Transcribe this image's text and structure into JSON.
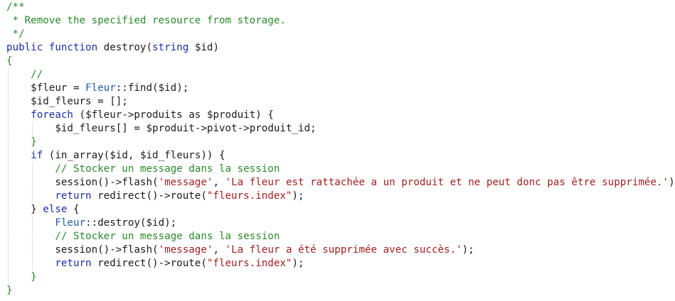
{
  "editor": {
    "language": "php",
    "lines": [
      {
        "indent": 0,
        "tokens": [
          {
            "t": "/**",
            "k": "comment"
          }
        ]
      },
      {
        "indent": 0,
        "tokens": [
          {
            "t": " * Remove the specified resource from storage.",
            "k": "comment"
          }
        ]
      },
      {
        "indent": 0,
        "tokens": [
          {
            "t": " */",
            "k": "comment"
          }
        ]
      },
      {
        "indent": 0,
        "tokens": [
          {
            "t": "public function ",
            "k": "keyword"
          },
          {
            "t": "destroy(",
            "k": "plain"
          },
          {
            "t": "string ",
            "k": "keyword"
          },
          {
            "t": "$id",
            "k": "variable"
          },
          {
            "t": ")",
            "k": "plain"
          }
        ]
      },
      {
        "indent": 0,
        "tokens": [
          {
            "t": "{",
            "k": "comment"
          }
        ]
      },
      {
        "indent": 1,
        "tokens": [
          {
            "t": "//",
            "k": "comment"
          }
        ]
      },
      {
        "indent": 1,
        "tokens": [
          {
            "t": "$fleur",
            "k": "variable"
          },
          {
            "t": " = ",
            "k": "plain"
          },
          {
            "t": "Fleur",
            "k": "class"
          },
          {
            "t": "::find(",
            "k": "plain"
          },
          {
            "t": "$id",
            "k": "variable"
          },
          {
            "t": ");",
            "k": "plain"
          }
        ]
      },
      {
        "indent": 1,
        "tokens": [
          {
            "t": "$id_fleurs",
            "k": "variable"
          },
          {
            "t": " = [];",
            "k": "plain"
          }
        ]
      },
      {
        "indent": 1,
        "tokens": [
          {
            "t": "foreach",
            "k": "keyword"
          },
          {
            "t": " (",
            "k": "plain"
          },
          {
            "t": "$fleur",
            "k": "variable"
          },
          {
            "t": "->produits as ",
            "k": "plain"
          },
          {
            "t": "$produit",
            "k": "variable"
          },
          {
            "t": ") {",
            "k": "plain"
          }
        ]
      },
      {
        "indent": 2,
        "tokens": [
          {
            "t": "$id_fleurs",
            "k": "variable"
          },
          {
            "t": "[] = ",
            "k": "plain"
          },
          {
            "t": "$produit",
            "k": "variable"
          },
          {
            "t": "->pivot->produit_id;",
            "k": "plain"
          }
        ]
      },
      {
        "indent": 1,
        "tokens": [
          {
            "t": "}",
            "k": "comment"
          }
        ]
      },
      {
        "indent": 1,
        "tokens": [
          {
            "t": "if",
            "k": "keyword"
          },
          {
            "t": " (in_array(",
            "k": "plain"
          },
          {
            "t": "$id",
            "k": "variable"
          },
          {
            "t": ", ",
            "k": "plain"
          },
          {
            "t": "$id_fleurs",
            "k": "variable"
          },
          {
            "t": ")) {",
            "k": "plain"
          }
        ]
      },
      {
        "indent": 2,
        "tokens": [
          {
            "t": "// Stocker un message dans la session",
            "k": "comment"
          }
        ]
      },
      {
        "indent": 2,
        "tokens": [
          {
            "t": "session()->flash(",
            "k": "plain"
          },
          {
            "t": "'message'",
            "k": "string"
          },
          {
            "t": ", ",
            "k": "plain"
          },
          {
            "t": "'La fleur est rattachée a un produit et ne peut donc pas être supprimée.'",
            "k": "string"
          },
          {
            "t": ");",
            "k": "plain"
          }
        ]
      },
      {
        "indent": 2,
        "tokens": [
          {
            "t": "return",
            "k": "keyword"
          },
          {
            "t": " redirect()->route(",
            "k": "plain"
          },
          {
            "t": "\"fleurs.index\"",
            "k": "string"
          },
          {
            "t": ");",
            "k": "plain"
          }
        ]
      },
      {
        "indent": 1,
        "tokens": [
          {
            "t": "} ",
            "k": "plain"
          },
          {
            "t": "else",
            "k": "keyword"
          },
          {
            "t": " {",
            "k": "plain"
          }
        ]
      },
      {
        "indent": 2,
        "tokens": [
          {
            "t": "Fleur",
            "k": "class"
          },
          {
            "t": "::destroy(",
            "k": "plain"
          },
          {
            "t": "$id",
            "k": "variable"
          },
          {
            "t": ");",
            "k": "plain"
          }
        ]
      },
      {
        "indent": 2,
        "tokens": [
          {
            "t": "// Stocker un message dans la session",
            "k": "comment"
          }
        ]
      },
      {
        "indent": 2,
        "tokens": [
          {
            "t": "session()->flash(",
            "k": "plain"
          },
          {
            "t": "'message'",
            "k": "string"
          },
          {
            "t": ", ",
            "k": "plain"
          },
          {
            "t": "'La fleur a été supprimée avec succès.'",
            "k": "string"
          },
          {
            "t": ");",
            "k": "plain"
          }
        ]
      },
      {
        "indent": 2,
        "tokens": [
          {
            "t": "return",
            "k": "keyword"
          },
          {
            "t": " redirect()->route(",
            "k": "plain"
          },
          {
            "t": "\"fleurs.index\"",
            "k": "string"
          },
          {
            "t": ");",
            "k": "plain"
          }
        ]
      },
      {
        "indent": 1,
        "tokens": [
          {
            "t": "}",
            "k": "comment"
          }
        ]
      },
      {
        "indent": 0,
        "tokens": [
          {
            "t": "}",
            "k": "comment"
          }
        ]
      }
    ]
  },
  "colors": {
    "comment": "#2a8a2a",
    "keyword": "#1d2fa8",
    "string": "#a31f1f",
    "class": "#2060a8",
    "background": "#ffffff"
  }
}
